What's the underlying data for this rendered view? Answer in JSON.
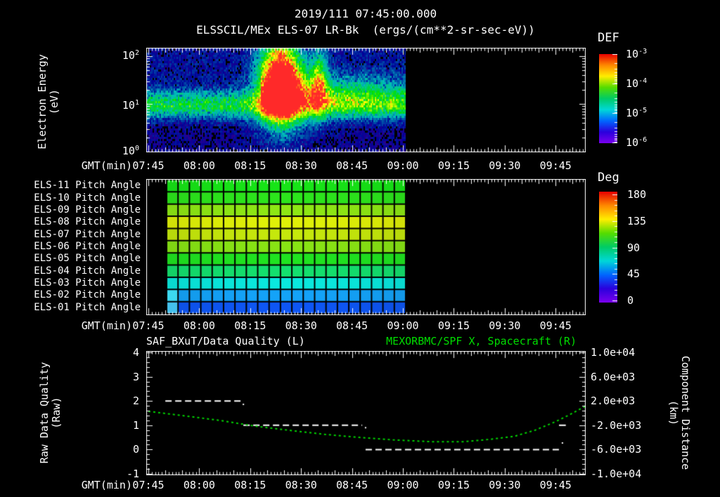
{
  "header": {
    "datetime": "2019/111 07:45:00.000",
    "title": "ELSSCIL/MEx ELS-07 LR-Bk  (ergs/(cm**2-sr-sec-eV))"
  },
  "time_axis": {
    "label": "GMT(min)",
    "tick_labels": [
      "07:45",
      "08:00",
      "08:15",
      "08:30",
      "08:45",
      "09:00",
      "09:15",
      "09:30",
      "09:45"
    ],
    "tick_minutes": [
      0,
      15,
      30,
      45,
      60,
      75,
      90,
      105,
      120
    ]
  },
  "panel_energy": {
    "ylabel1": "Electron Energy",
    "ylabel2": "(eV)",
    "ytick_labels": [
      {
        "base": "10",
        "exp": "2"
      },
      {
        "base": "10",
        "exp": "1"
      },
      {
        "base": "10",
        "exp": "0"
      }
    ],
    "colorbar": {
      "title": "DEF",
      "tick_labels": [
        {
          "base": "10",
          "exp": "-3"
        },
        {
          "base": "10",
          "exp": "-4"
        },
        {
          "base": "10",
          "exp": "-5"
        },
        {
          "base": "10",
          "exp": "-6"
        }
      ]
    }
  },
  "panel_pitch": {
    "colorbar": {
      "title": "Deg",
      "tick_labels": [
        "180",
        "135",
        "90",
        "45",
        "0"
      ]
    }
  },
  "panel_quality": {
    "title_left": "SAF_BXuT/Data Quality (L)",
    "title_right": "MEXORBMC/SPF X, Spacecraft (R)",
    "title_right_color": "#00dd00",
    "ylabel_left1": "Raw Data Quality",
    "ylabel_left2": "(Raw)",
    "ylabel_right1": "Component Distance",
    "ylabel_right2": "(km)",
    "ytick_left": [
      "4",
      "3",
      "2",
      "1",
      "0",
      "-1"
    ],
    "ytick_right": [
      "1.0e+04",
      "6.0e+03",
      "2.0e+03",
      "-2.0e+03",
      "-6.0e+03",
      "-1.0e+04"
    ]
  },
  "chart_data": [
    {
      "type": "heatmap",
      "name": "electron-energy-spectrogram",
      "title": "ELSSCIL/MEx ELS-07 LR-Bk",
      "units": "ergs/(cm**2-sr-sec-eV)",
      "x_axis": "GMT 07:45 - 09:53",
      "data_time_range": [
        "07:45",
        "09:01"
      ],
      "y_scale": "log",
      "y_range_eV": [
        1,
        150
      ],
      "colorbar_label": "DEF",
      "colorbar_range": [
        "1e-6",
        "1e-3"
      ],
      "features": [
        {
          "name": "background-noise",
          "level": "~1e-6 to 1e-5 (blue/violet speckle)",
          "time": [
            "07:45",
            "09:01"
          ],
          "energy_eV": [
            1,
            150
          ]
        },
        {
          "name": "persistent-band",
          "level": "~1e-5 to 1e-4.5 (cyan)",
          "time": [
            "07:45",
            "09:01"
          ],
          "energy_eV": [
            7,
            16
          ]
        },
        {
          "name": "main-burst",
          "level": "up to ~1e-3 (yellow/red core)",
          "time": [
            "08:17",
            "08:30"
          ],
          "energy_eV": [
            4,
            150
          ],
          "core_energy_eV": [
            15,
            40
          ]
        },
        {
          "name": "secondary-burst",
          "level": "~1e-4 (green)",
          "time": [
            "08:33",
            "08:38"
          ],
          "energy_eV": [
            4,
            100
          ]
        },
        {
          "name": "post-burst-broadened-band",
          "level": "~1e-4 (green)",
          "time": [
            "08:30",
            "09:01"
          ],
          "energy_eV": [
            5,
            40
          ]
        },
        {
          "name": "no-data",
          "time": [
            "09:01",
            "09:53"
          ],
          "level": "black"
        }
      ]
    },
    {
      "type": "heatmap",
      "name": "pitch-angle-grid",
      "data_time_range": [
        "07:50",
        "09:00"
      ],
      "columns": 21,
      "colorbar_label": "Deg",
      "colorbar_range": [
        0,
        180
      ],
      "rows": [
        {
          "label": "ELS-11 Pitch Angle",
          "color": "#17e017",
          "mean_pitch_deg": 105
        },
        {
          "label": "ELS-10 Pitch Angle",
          "color": "#2ce11c",
          "mean_pitch_deg": 108
        },
        {
          "label": "ELS-09 Pitch Angle",
          "color": "#8ce414",
          "mean_pitch_deg": 118
        },
        {
          "label": "ELS-08 Pitch Angle",
          "color": "#dcec08",
          "mean_pitch_deg": 130
        },
        {
          "label": "ELS-07 Pitch Angle",
          "color": "#c2e40c",
          "mean_pitch_deg": 125
        },
        {
          "label": "ELS-06 Pitch Angle",
          "color": "#86e014",
          "mean_pitch_deg": 117
        },
        {
          "label": "ELS-05 Pitch Angle",
          "color": "#20e020",
          "mean_pitch_deg": 106
        },
        {
          "label": "ELS-04 Pitch Angle",
          "color": "#14dc6c",
          "mean_pitch_deg": 95
        },
        {
          "label": "ELS-03 Pitch Angle",
          "color": "#0ae4da",
          "mean_pitch_deg": 80
        },
        {
          "label": "ELS-02 Pitch Angle",
          "color": "#14a0f4",
          "left_color": "#3cd8f0",
          "mean_pitch_deg": 60
        },
        {
          "label": "ELS-01 Pitch Angle",
          "color": "#0e55f0",
          "left_color": "#44c0ec",
          "mean_pitch_deg": 47
        }
      ]
    },
    {
      "type": "line",
      "name": "quality-and-spacecraft-distance",
      "ylim_left": [
        -1,
        4
      ],
      "ylim_right": [
        -10000,
        10000
      ],
      "series": [
        {
          "name": "SAF_BXuT/Data Quality",
          "axis": "left",
          "style": "white dashed step segments",
          "segments": [
            {
              "t1": "07:50",
              "t2": "08:13",
              "value": 2
            },
            {
              "t1": "08:13",
              "t2": "08:48",
              "value": 1
            },
            {
              "t1": "08:49",
              "t2": "09:47",
              "value": 0
            }
          ],
          "extra_marks": [
            {
              "type": "dot",
              "t": "08:13",
              "value": 1.86
            },
            {
              "type": "dot",
              "t": "08:49",
              "value": 0.9
            },
            {
              "type": "dash",
              "t1": "09:46",
              "t2": "09:48",
              "value": 1.0
            },
            {
              "type": "dot",
              "t": "09:47",
              "value": 0.27
            }
          ]
        },
        {
          "name": "MEXORBMC/SPF X, Spacecraft",
          "axis": "right",
          "style": "green dotted curve",
          "color": "#00d400",
          "points_time_km": [
            [
              "07:45",
              300
            ],
            [
              "07:55",
              -400
            ],
            [
              "08:06",
              -1200
            ],
            [
              "08:16",
              -2100
            ],
            [
              "08:26",
              -2800
            ],
            [
              "08:37",
              -3500
            ],
            [
              "08:47",
              -4000
            ],
            [
              "08:57",
              -4400
            ],
            [
              "09:08",
              -4700
            ],
            [
              "09:18",
              -4700
            ],
            [
              "09:26",
              -4300
            ],
            [
              "09:33",
              -3800
            ],
            [
              "09:39",
              -2800
            ],
            [
              "09:45",
              -1400
            ],
            [
              "09:49",
              -300
            ],
            [
              "09:54",
              1200
            ]
          ]
        }
      ]
    }
  ],
  "colors": {
    "background": "#000000",
    "foreground": "#ffffff",
    "accent_green": "#00dd00",
    "rainbow_top_to_bottom": [
      "#e80000",
      "#ff8800",
      "#ffee00",
      "#55dd00",
      "#00cc66",
      "#00d8d8",
      "#0066ff",
      "#2b00dd",
      "#7a00ee"
    ]
  }
}
